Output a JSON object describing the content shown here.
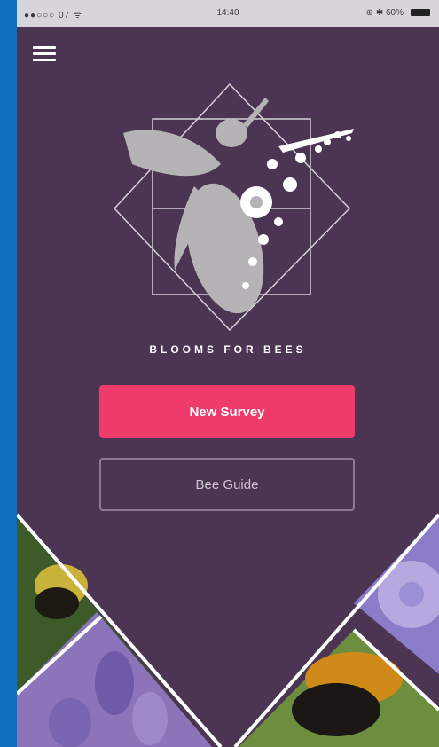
{
  "status_bar": {
    "left_text": "●●○○○ 07  ᯤ",
    "time": "14:40",
    "right_text": "⊕ ✱ 60%"
  },
  "app": {
    "brand": "BLOOMS FOR BEES",
    "primary_button_label": "New Survey",
    "secondary_button_label": "Bee Guide"
  },
  "colors": {
    "background": "#4b3553",
    "primary_button": "#ee3b6b",
    "frame": "#0f6fbd"
  },
  "icons": {
    "menu": "hamburger-menu-icon",
    "logo": "bee-flower-logo"
  }
}
